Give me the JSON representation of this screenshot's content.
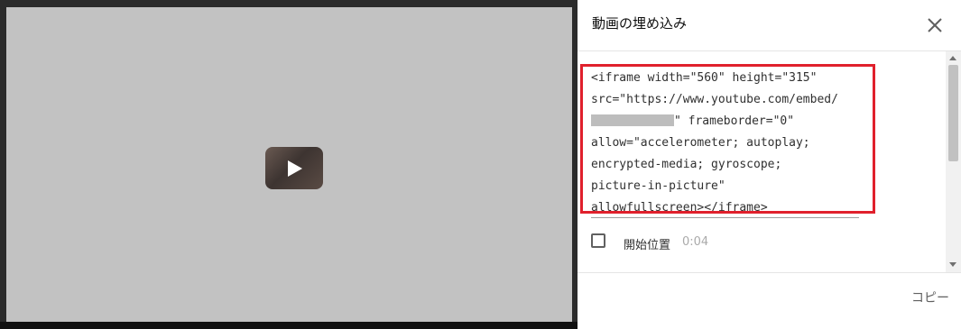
{
  "dialog": {
    "title": "動画の埋め込み",
    "close_icon": "close-icon"
  },
  "video": {
    "play_icon": "play-icon"
  },
  "embed": {
    "code_lines": [
      "<iframe width=\"560\" height=\"315\"",
      "src=\"https://www.youtube.com/embed/",
      "\" frameborder=\"0\"",
      "allow=\"accelerometer; autoplay;",
      "encrypted-media; gyroscope;",
      "picture-in-picture\"",
      "allowfullscreen></iframe>"
    ],
    "highlight_color": "#e0202c"
  },
  "start_at": {
    "label": "開始位置",
    "time": "0:04",
    "checked": false
  },
  "actions": {
    "copy_label": "コピー"
  }
}
